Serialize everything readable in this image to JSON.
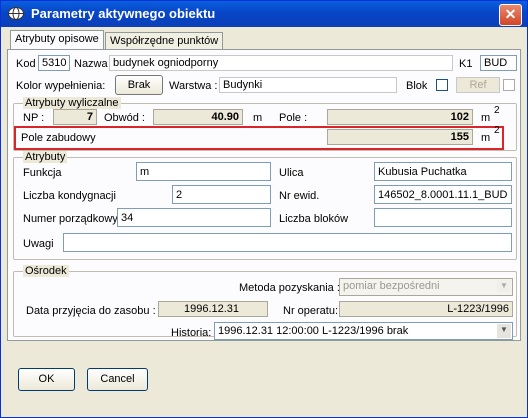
{
  "window": {
    "title": "Parametry aktywnego obiektu",
    "close_label": "✕"
  },
  "tabs": [
    {
      "label": "Atrybuty opisowe",
      "active": true
    },
    {
      "label": "Współrzędne punktów",
      "active": false
    }
  ],
  "header": {
    "kod_label": "Kod",
    "kod_value": "5310",
    "nazwa_label": "Nazwa",
    "nazwa_value": "budynek ogniodporny",
    "k1_label": "K1",
    "k1_value": "BUD",
    "kolor_label": "Kolor wypełnienia:",
    "kolor_button": "Brak",
    "warstwa_label": "Warstwa :",
    "warstwa_value": "Budynki",
    "blok_label": "Blok",
    "ref_label": "Ref"
  },
  "computed": {
    "group_label": "Atrybuty wyliczalne",
    "np_label": "NP :",
    "np_value": "7",
    "obwod_label": "Obwód :",
    "obwod_value": "40.90",
    "obwod_unit": "m",
    "pole_label": "Pole :",
    "pole_value": "102",
    "pole_unit": "m",
    "pole_sup": "2",
    "zabudowy_label": "Pole zabudowy",
    "zabudowy_value": "155",
    "zabudowy_unit": "m",
    "zabudowy_sup": "2"
  },
  "attributes": {
    "group_label": "Atrybuty",
    "funkcja_label": "Funkcja",
    "funkcja_value": "m",
    "ulica_label": "Ulica",
    "ulica_value": "Kubusia Puchatka",
    "kondygnacje_label": "Liczba kondygnacji",
    "kondygnacje_value": "2",
    "ewid_label": "Nr ewid.",
    "ewid_value": "146502_8.0001.11.1_BUD",
    "porzadkowy_label": "Numer porządkowy",
    "porzadkowy_value": "34",
    "bloki_label": "Liczba bloków",
    "bloki_value": "",
    "uwagi_label": "Uwagi",
    "uwagi_value": ""
  },
  "osrodek": {
    "group_label": "Ośrodek",
    "metoda_label": "Metoda pozyskania :",
    "metoda_value": "pomiar bezpośredni",
    "data_label": "Data przyjęcia do zasobu :",
    "data_value": "1996.12.31",
    "operat_label": "Nr operatu:",
    "operat_value": "L-1223/1996",
    "historia_label": "Historia:",
    "historia_value": "1996.12.31 12:00:00 L-1223/1996 brak"
  },
  "footer": {
    "ok_label": "OK",
    "cancel_label": "Cancel"
  },
  "colors": {
    "highlight": "#d9252a",
    "title_blue": "#0a5fde"
  }
}
